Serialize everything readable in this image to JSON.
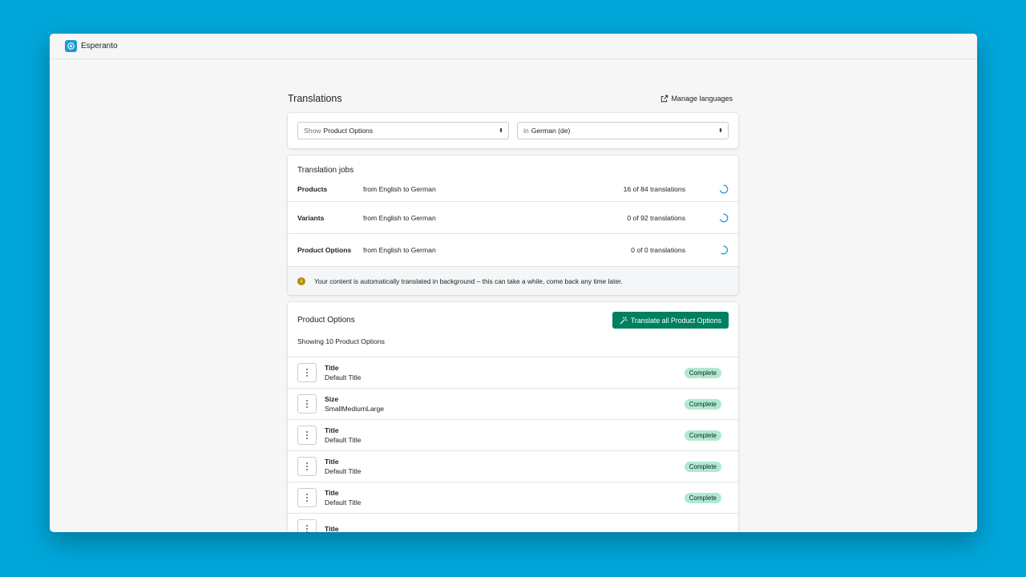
{
  "app": {
    "name": "Esperanto"
  },
  "page": {
    "title": "Translations",
    "manage_languages": "Manage languages"
  },
  "filters": {
    "show": {
      "prefix": "Show",
      "value": "Product Options"
    },
    "language": {
      "prefix": "in",
      "value": "German (de)"
    }
  },
  "jobs": {
    "title": "Translation jobs",
    "rows": [
      {
        "name": "Products",
        "direction": "from English to German",
        "count": "16 of 84 translations"
      },
      {
        "name": "Variants",
        "direction": "from English to German",
        "count": "0 of 92 translations"
      },
      {
        "name": "Product Options",
        "direction": "from English to German",
        "count": "0 of 0 translations"
      }
    ],
    "info": "Your content is automatically translated in background – this can take a while, come back any time later."
  },
  "options": {
    "title": "Product Options",
    "translate_all": "Translate all Product Options",
    "showing": "Showing 10 Product Options",
    "rows": [
      {
        "name": "Title",
        "value": "Default Title",
        "status": "Complete"
      },
      {
        "name": "Size",
        "value": "SmallMediumLarge",
        "status": "Complete"
      },
      {
        "name": "Title",
        "value": "Default Title",
        "status": "Complete"
      },
      {
        "name": "Title",
        "value": "Default Title",
        "status": "Complete"
      },
      {
        "name": "Title",
        "value": "Default Title",
        "status": "Complete"
      },
      {
        "name": "Title",
        "value": "",
        "status": ""
      }
    ]
  },
  "colors": {
    "background": "#00a6d9",
    "primary": "#008060",
    "badge": "#aee9d1",
    "spinner": "#1e9ad6",
    "info": "#b98900"
  }
}
